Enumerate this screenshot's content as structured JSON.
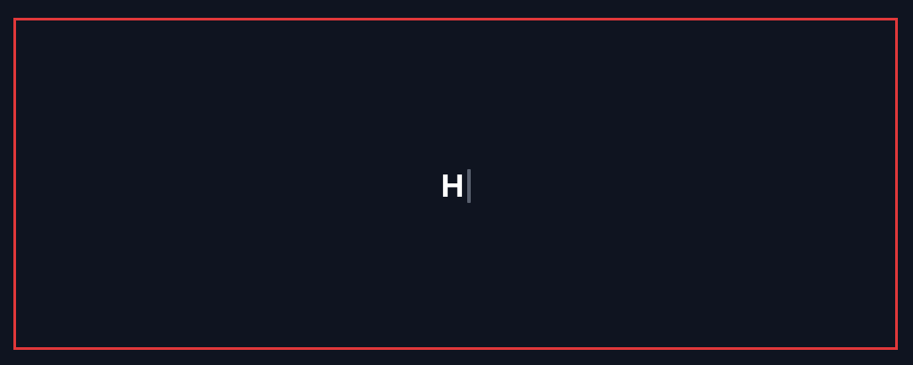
{
  "colors": {
    "background": "#0f1420",
    "border": "#e0383a",
    "text": "#ffffff",
    "caret": "#59606e"
  },
  "editor": {
    "text": "H",
    "caret": "text-caret"
  }
}
